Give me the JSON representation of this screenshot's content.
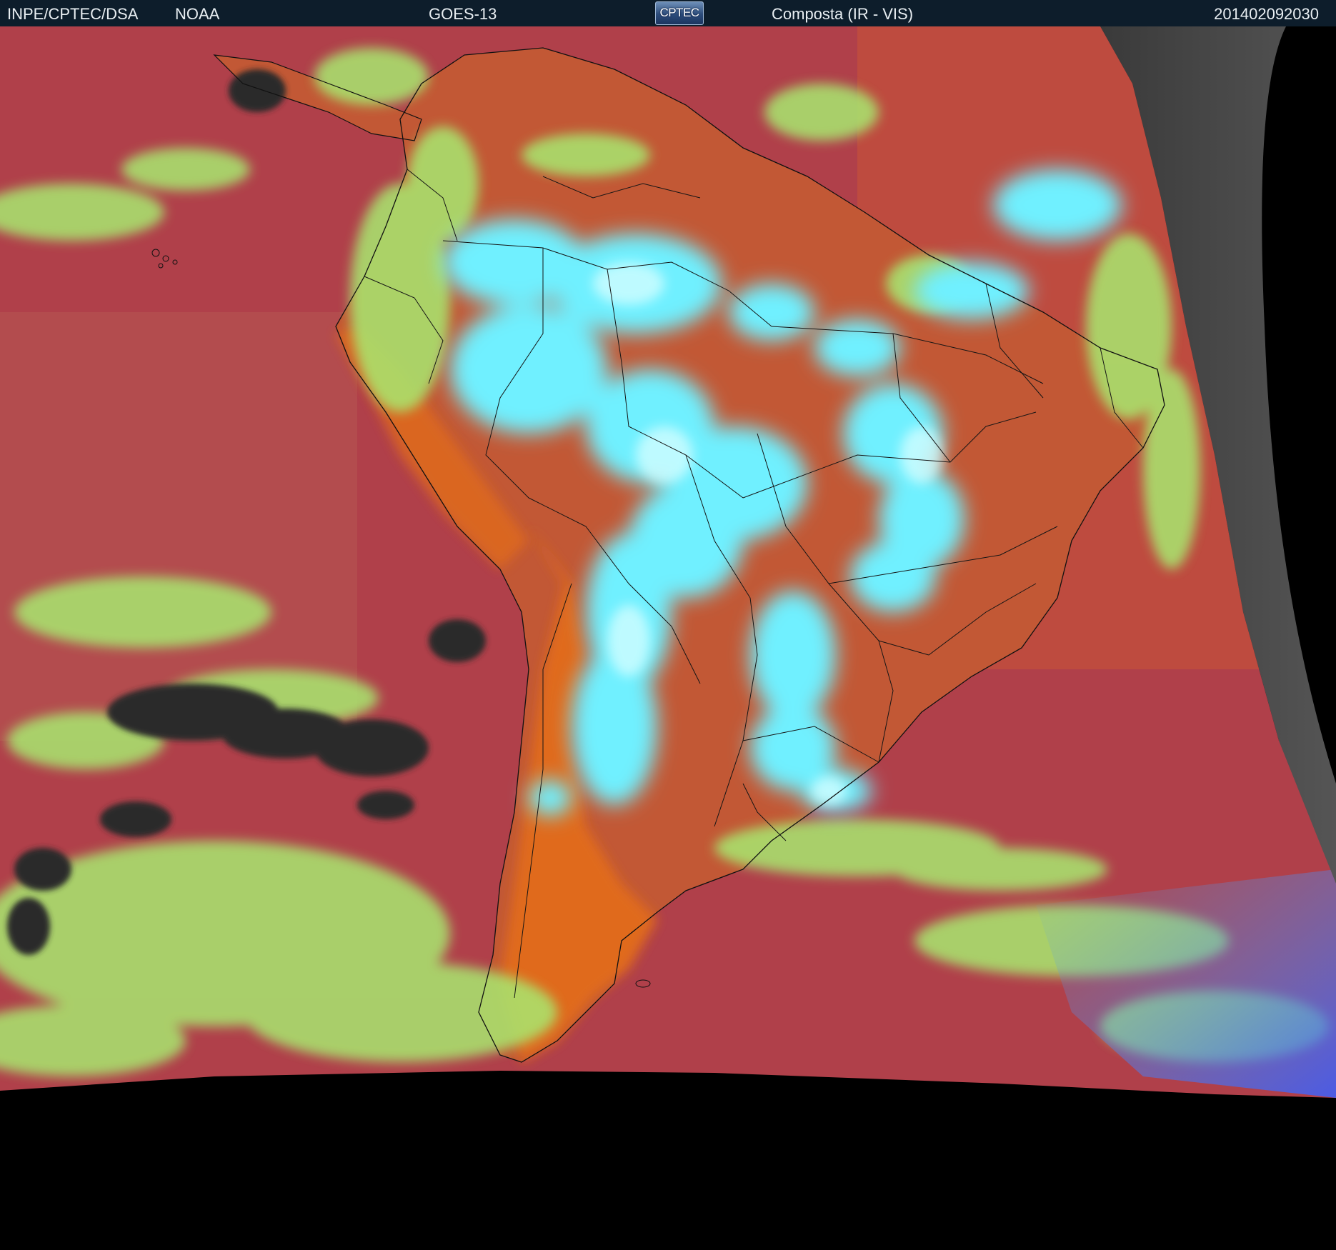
{
  "header": {
    "institution": "INPE/CPTEC/DSA",
    "agency": "NOAA",
    "satellite": "GOES-13",
    "logo_text": "CPTEC",
    "product": "Composta (IR - VIS)",
    "timestamp": "201402092030"
  },
  "colors": {
    "header_bg": "#0d1d2b",
    "ocean": "#b0404a",
    "land": "#c45a30",
    "desert": "#e06a1e",
    "high_cloud": "#6ff0ff",
    "low_cloud": "#a8e870",
    "clear_cold": "#2a2a2a",
    "visible_gray": "#4a4a4a",
    "background": "#000000"
  },
  "map": {
    "region": "South America",
    "borders": "country and state boundaries"
  }
}
